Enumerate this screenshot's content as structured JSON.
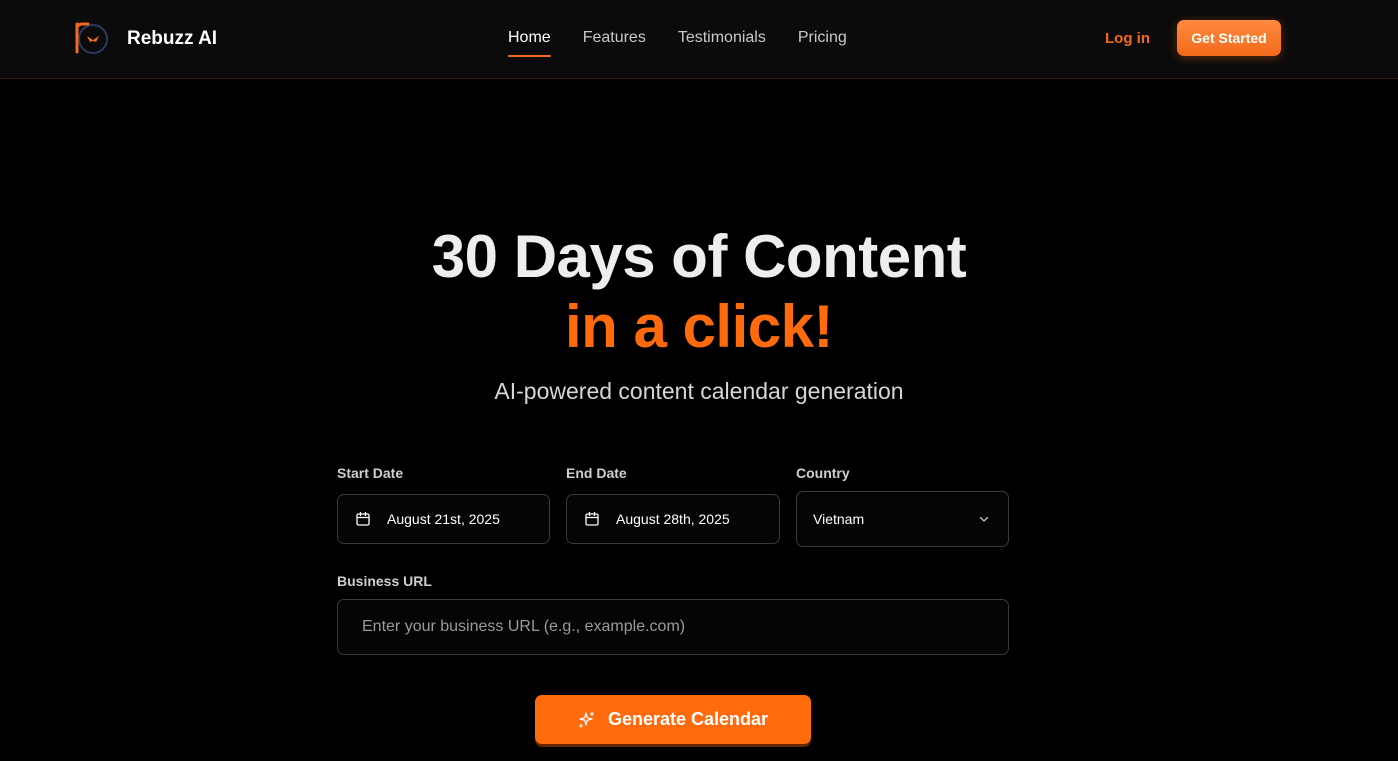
{
  "header": {
    "brand": "Rebuzz AI",
    "nav": [
      {
        "label": "Home",
        "active": true
      },
      {
        "label": "Features",
        "active": false
      },
      {
        "label": "Testimonials",
        "active": false
      },
      {
        "label": "Pricing",
        "active": false
      }
    ],
    "login_label": "Log in",
    "cta_label": "Get Started"
  },
  "hero": {
    "title_line1": "30 Days of Content",
    "title_line2": "in a click!",
    "subtitle": "AI-powered content calendar generation"
  },
  "form": {
    "start_date": {
      "label": "Start Date",
      "value": "August 21st, 2025",
      "icon": "calendar-icon"
    },
    "end_date": {
      "label": "End Date",
      "value": "August 28th, 2025",
      "icon": "calendar-icon"
    },
    "country": {
      "label": "Country",
      "value": "Vietnam",
      "icon": "chevron-down-icon"
    },
    "business_url": {
      "label": "Business URL",
      "value": "",
      "placeholder": "Enter your business URL (e.g., example.com)"
    },
    "submit_label": "Generate Calendar",
    "submit_icon": "sparkles-icon"
  },
  "colors": {
    "accent": "#ff6a0c",
    "background": "#000000",
    "header_bg": "#0b0b0b"
  }
}
